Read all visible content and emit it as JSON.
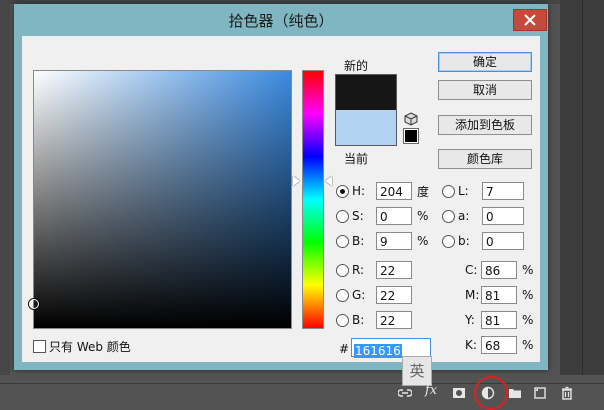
{
  "dialog": {
    "title": "拾色器（纯色）",
    "close_icon": "close-icon"
  },
  "swatches": {
    "new_label": "新的",
    "current_label": "当前",
    "new_color": "#161616",
    "current_color": "#b1d2f1"
  },
  "buttons": {
    "ok": "确定",
    "cancel": "取消",
    "add_to_swatches": "添加到色板",
    "color_libraries": "颜色库"
  },
  "hsb": {
    "h": {
      "label": "H:",
      "value": "204",
      "unit": "度",
      "selected": true
    },
    "s": {
      "label": "S:",
      "value": "0",
      "unit": "%"
    },
    "b": {
      "label": "B:",
      "value": "9",
      "unit": "%"
    }
  },
  "lab": {
    "l": {
      "label": "L:",
      "value": "7"
    },
    "a": {
      "label": "a:",
      "value": "0"
    },
    "b": {
      "label": "b:",
      "value": "0"
    }
  },
  "rgb": {
    "r": {
      "label": "R:",
      "value": "22"
    },
    "g": {
      "label": "G:",
      "value": "22"
    },
    "b": {
      "label": "B:",
      "value": "22"
    }
  },
  "cmyk": {
    "c": {
      "label": "C:",
      "value": "86",
      "unit": "%"
    },
    "m": {
      "label": "M:",
      "value": "81",
      "unit": "%"
    },
    "y": {
      "label": "Y:",
      "value": "81",
      "unit": "%"
    },
    "k": {
      "label": "K:",
      "value": "68",
      "unit": "%"
    }
  },
  "hex": {
    "hash": "#",
    "value": "161616"
  },
  "web_only_label": "只有 Web 颜色",
  "ime_badge": "英",
  "toolbar": {
    "fx_label": "fx"
  }
}
